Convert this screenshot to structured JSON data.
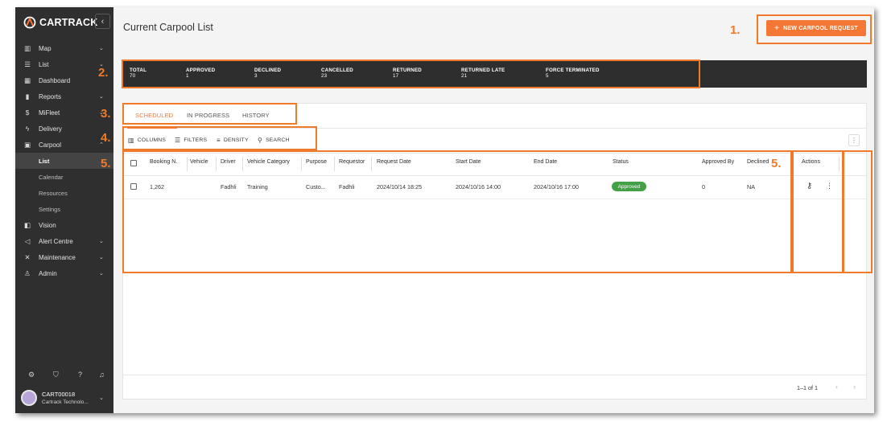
{
  "brand": {
    "name": "CARTRACK",
    "accent": "#f47735"
  },
  "sidebar": {
    "collapse_icon": "chevron-left-icon",
    "items": [
      {
        "label": "Map",
        "icon": "map-icon",
        "expandable": true
      },
      {
        "label": "List",
        "icon": "list-icon",
        "expandable": true
      },
      {
        "label": "Dashboard",
        "icon": "dashboard-icon",
        "expandable": false
      },
      {
        "label": "Reports",
        "icon": "bar-chart-icon",
        "expandable": true
      },
      {
        "label": "MiFleet",
        "icon": "dollar-icon",
        "expandable": true
      },
      {
        "label": "Delivery",
        "icon": "bolt-icon",
        "expandable": false
      },
      {
        "label": "Carpool",
        "icon": "calendar-icon",
        "expandable": true
      },
      {
        "label": "Vision",
        "icon": "camera-icon",
        "expandable": false
      },
      {
        "label": "Alert Centre",
        "icon": "megaphone-icon",
        "expandable": true
      },
      {
        "label": "Maintenance",
        "icon": "wrench-icon",
        "expandable": true
      },
      {
        "label": "Admin",
        "icon": "admin-icon",
        "expandable": true
      }
    ],
    "carpool_sub": [
      "List",
      "Calendar",
      "Resources",
      "Settings"
    ],
    "active_sub": "List",
    "bottom_icons": [
      "gear-icon",
      "shield-icon",
      "help-icon",
      "bell-icon"
    ],
    "user": {
      "name": "CART00018",
      "company": "Cartrack Technolo..."
    }
  },
  "header": {
    "title": "Current Carpool List",
    "new_request_label": "NEW CARPOOL REQUEST"
  },
  "stats": [
    {
      "label": "TOTAL",
      "value": "70"
    },
    {
      "label": "APPROVED",
      "value": "1"
    },
    {
      "label": "DECLINED",
      "value": "3"
    },
    {
      "label": "CANCELLED",
      "value": "23"
    },
    {
      "label": "RETURNED",
      "value": "17"
    },
    {
      "label": "RETURNED LATE",
      "value": "21"
    },
    {
      "label": "FORCE TERMINATED",
      "value": "5"
    }
  ],
  "tabs": [
    {
      "label": "SCHEDULED",
      "active": true
    },
    {
      "label": "IN PROGRESS",
      "active": false
    },
    {
      "label": "HISTORY",
      "active": false
    }
  ],
  "toolbar": {
    "columns": "COLUMNS",
    "filters": "FILTERS",
    "density": "DENSITY",
    "search": "SEARCH"
  },
  "table": {
    "headers": [
      "Booking N.",
      "Vehicle",
      "Driver",
      "Vehicle Category",
      "Purpose",
      "Requestor",
      "Request Date",
      "Start Date",
      "End Date",
      "Status",
      "Approved By",
      "Declined",
      "Actions"
    ],
    "rows": [
      {
        "booking": "1,262",
        "vehicle": "",
        "driver": "Fadhli",
        "category": "Training",
        "purpose": "Custo...",
        "requestor": "Fadhli",
        "request_date": "2024/10/14 18:25",
        "start_date": "2024/10/16 14:00",
        "end_date": "2024/10/16 17:00",
        "status": "Approved",
        "approved_by": "0",
        "declined": "NA"
      }
    ],
    "status_color": "#43a047"
  },
  "pagination": {
    "range": "1–1 of 1"
  },
  "annotations": [
    "1.",
    "2.",
    "3.",
    "4.",
    "5.",
    "5."
  ],
  "annotation_color": "#f07a2a"
}
